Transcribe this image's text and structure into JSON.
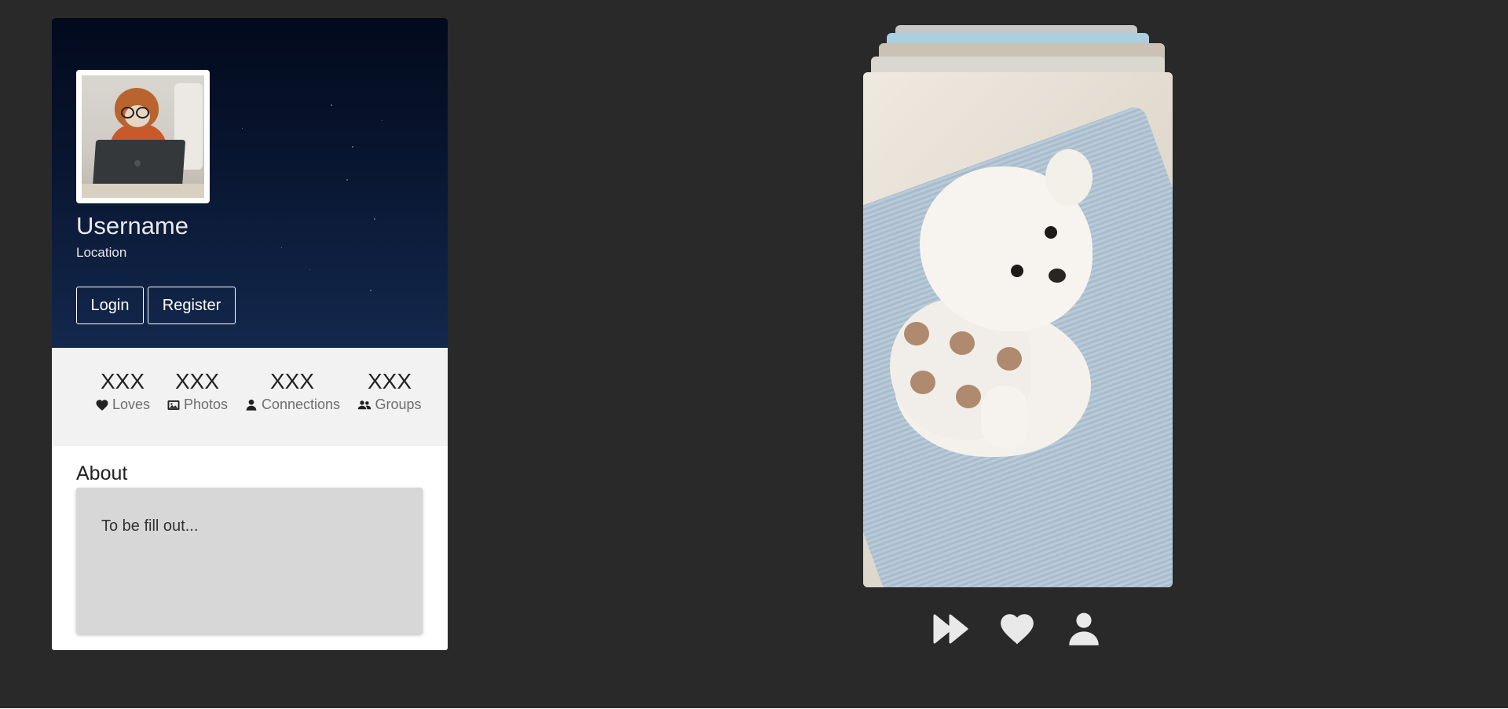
{
  "profile": {
    "username": "Username",
    "location": "Location",
    "login_label": "Login",
    "register_label": "Register",
    "avatar": "dog-with-glasses-at-laptop"
  },
  "stats": [
    {
      "value": "XXX",
      "label": "Loves",
      "icon": "heart-icon"
    },
    {
      "value": "XXX",
      "label": "Photos",
      "icon": "image-icon"
    },
    {
      "value": "XXX",
      "label": "Connections",
      "icon": "user-icon"
    },
    {
      "value": "XXX",
      "label": "Groups",
      "icon": "users-icon"
    }
  ],
  "about": {
    "title": "About",
    "text": "To be fill out..."
  },
  "card_stack": {
    "photo": "white-poodle-in-bear-sweater-on-blue-blanket"
  },
  "actions": [
    {
      "name": "skip",
      "icon": "fast-forward-icon"
    },
    {
      "name": "love",
      "icon": "heart-icon"
    },
    {
      "name": "view-profile",
      "icon": "user-icon"
    }
  ],
  "colors": {
    "background": "#292929",
    "header_dark": "#020a1c",
    "header_light": "#13284d",
    "stats_bar": "#f2f2f2",
    "about_box": "#d7d7d7",
    "action_icon": "#e9e9e9"
  }
}
